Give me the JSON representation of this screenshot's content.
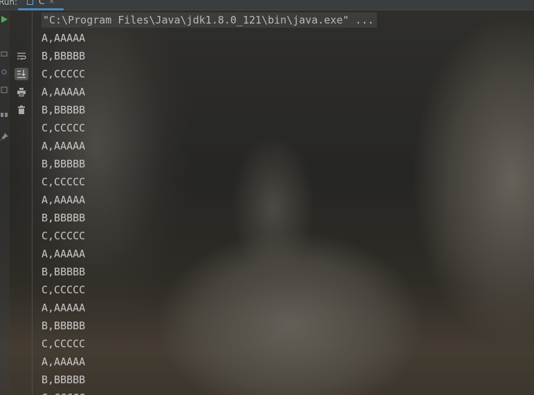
{
  "panel": {
    "run_label": "Run:",
    "tab_label": "C",
    "tab_close": "×"
  },
  "toolbar": {
    "buttons": [
      {
        "name": "soft-wrap-icon",
        "active": false
      },
      {
        "name": "scroll-to-end-icon",
        "active": true
      },
      {
        "name": "print-icon",
        "active": false
      },
      {
        "name": "trash-icon",
        "active": false
      }
    ]
  },
  "console": {
    "command": "\"C:\\Program Files\\Java\\jdk1.8.0_121\\bin\\java.exe\" ...",
    "lines": [
      "A,AAAAA",
      "B,BBBBB",
      "C,CCCCC",
      "A,AAAAA",
      "B,BBBBB",
      "C,CCCCC",
      "A,AAAAA",
      "B,BBBBB",
      "C,CCCCC",
      "A,AAAAA",
      "B,BBBBB",
      "C,CCCCC",
      "A,AAAAA",
      "B,BBBBB",
      "C,CCCCC",
      "A,AAAAA",
      "B,BBBBB",
      "C,CCCCC",
      "A,AAAAA",
      "B,BBBBB",
      "C,CCCCC"
    ]
  },
  "colors": {
    "accent": "#4a88c7",
    "text": "#c8c8c8"
  }
}
